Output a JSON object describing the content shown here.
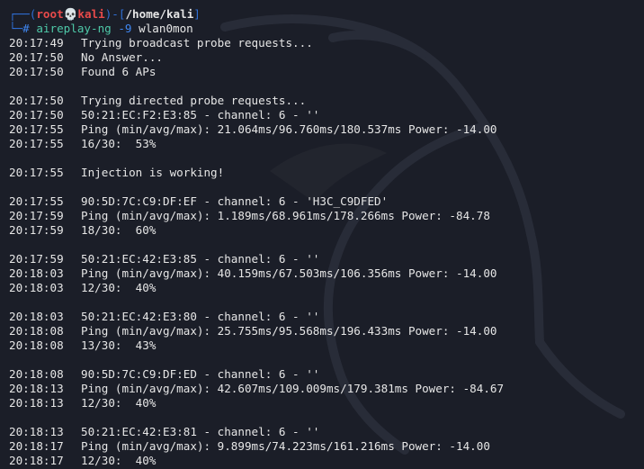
{
  "prompt": {
    "frame_open": "┌──(",
    "user": "root",
    "skull": "💀",
    "host": "kali",
    "frame_mid": ")-[",
    "path": "/home/kali",
    "frame_close": "]",
    "line2_frame": "└─",
    "dollar": "# "
  },
  "command": {
    "name": "aireplay-ng",
    "flag": "-9",
    "iface": "wlan0mon"
  },
  "output": [
    {
      "ts": "20:17:49",
      "msg": "Trying broadcast probe requests..."
    },
    {
      "ts": "20:17:50",
      "msg": "No Answer..."
    },
    {
      "ts": "20:17:50",
      "msg": "Found 6 APs"
    },
    {
      "ts": "",
      "msg": ""
    },
    {
      "ts": "20:17:50",
      "msg": "Trying directed probe requests..."
    },
    {
      "ts": "20:17:50",
      "msg": "50:21:EC:F2:E3:85 - channel: 6 - ''"
    },
    {
      "ts": "20:17:55",
      "msg": "Ping (min/avg/max): 21.064ms/96.760ms/180.537ms Power: -14.00"
    },
    {
      "ts": "20:17:55",
      "msg": "16/30:  53%"
    },
    {
      "ts": "",
      "msg": ""
    },
    {
      "ts": "20:17:55",
      "msg": "Injection is working!"
    },
    {
      "ts": "",
      "msg": ""
    },
    {
      "ts": "20:17:55",
      "msg": "90:5D:7C:C9:DF:EF - channel: 6 - 'H3C_C9DFED'"
    },
    {
      "ts": "20:17:59",
      "msg": "Ping (min/avg/max): 1.189ms/68.961ms/178.266ms Power: -84.78"
    },
    {
      "ts": "20:17:59",
      "msg": "18/30:  60%"
    },
    {
      "ts": "",
      "msg": ""
    },
    {
      "ts": "20:17:59",
      "msg": "50:21:EC:42:E3:85 - channel: 6 - ''"
    },
    {
      "ts": "20:18:03",
      "msg": "Ping (min/avg/max): 40.159ms/67.503ms/106.356ms Power: -14.00"
    },
    {
      "ts": "20:18:03",
      "msg": "12/30:  40%"
    },
    {
      "ts": "",
      "msg": ""
    },
    {
      "ts": "20:18:03",
      "msg": "50:21:EC:42:E3:80 - channel: 6 - ''"
    },
    {
      "ts": "20:18:08",
      "msg": "Ping (min/avg/max): 25.755ms/95.568ms/196.433ms Power: -14.00"
    },
    {
      "ts": "20:18:08",
      "msg": "13/30:  43%"
    },
    {
      "ts": "",
      "msg": ""
    },
    {
      "ts": "20:18:08",
      "msg": "90:5D:7C:C9:DF:ED - channel: 6 - ''"
    },
    {
      "ts": "20:18:13",
      "msg": "Ping (min/avg/max): 42.607ms/109.009ms/179.381ms Power: -84.67"
    },
    {
      "ts": "20:18:13",
      "msg": "12/30:  40%"
    },
    {
      "ts": "",
      "msg": ""
    },
    {
      "ts": "20:18:13",
      "msg": "50:21:EC:42:E3:81 - channel: 6 - ''"
    },
    {
      "ts": "20:18:17",
      "msg": "Ping (min/avg/max): 9.899ms/74.223ms/161.216ms Power: -14.00"
    },
    {
      "ts": "20:18:17",
      "msg": "12/30:  40%"
    }
  ],
  "colors": {
    "background": "#1b1e28",
    "text": "#e6e6e6",
    "prompt_frame": "#2f6fd6",
    "prompt_user": "#e84a4a",
    "command": "#4ec9a8"
  }
}
